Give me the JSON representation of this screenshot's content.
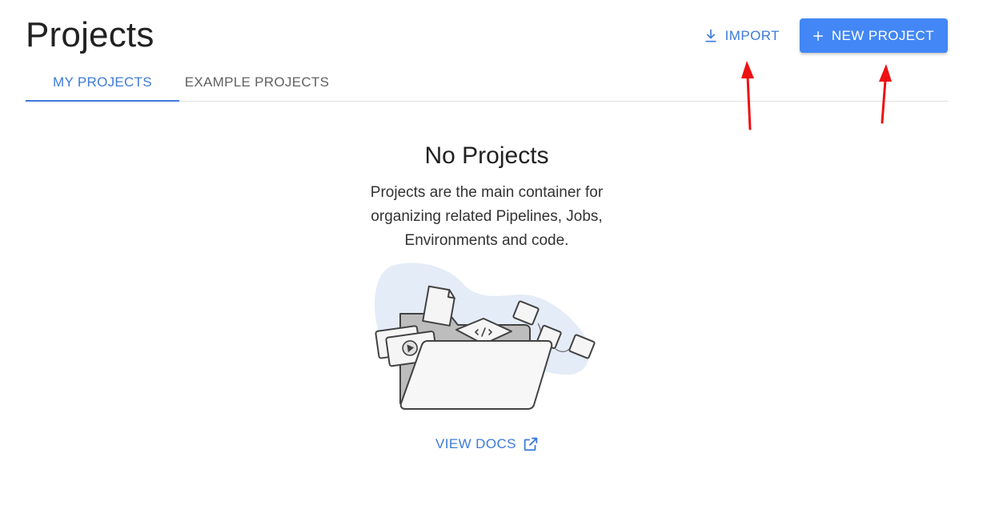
{
  "header": {
    "title": "Projects",
    "import_label": "IMPORT",
    "new_project_label": "NEW PROJECT"
  },
  "tabs": [
    {
      "label": "MY PROJECTS",
      "active": true
    },
    {
      "label": "EXAMPLE PROJECTS",
      "active": false
    }
  ],
  "empty_state": {
    "title": "No Projects",
    "description": "Projects are the main container for organizing related Pipelines, Jobs, Environments and code.",
    "docs_link_label": "VIEW DOCS"
  },
  "icons": {
    "import": "download-icon",
    "new_project": "plus-icon",
    "docs": "open-in-new-icon"
  },
  "colors": {
    "accent": "#3d7bd9",
    "primary_button": "#4287f5",
    "annotation_arrow": "#ee1111"
  }
}
